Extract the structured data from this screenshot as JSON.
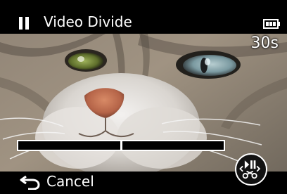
{
  "header": {
    "title": "Video Divide",
    "icons": [
      "pause-icon",
      "battery-icon"
    ]
  },
  "playback": {
    "duration": "30s",
    "progress_fraction": 0.5
  },
  "footer": {
    "cancel_label": "Cancel",
    "back_icon": "return-arrow-icon",
    "divide_icon": "divide-scissors-icon"
  },
  "colors": {
    "background": "#000000",
    "text": "#ffffff"
  }
}
